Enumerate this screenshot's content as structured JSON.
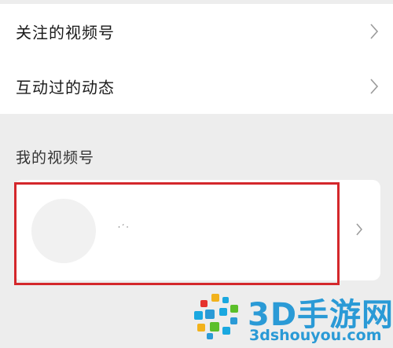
{
  "menu": {
    "items": [
      {
        "label": "关注的视频号"
      },
      {
        "label": "互动过的动态"
      }
    ]
  },
  "my_channels": {
    "section_title": "我的视频号",
    "card": {
      "name": "· ′ ·"
    }
  },
  "watermark": {
    "brand": "3D手游网",
    "url": "3dshouyou.com",
    "brand_color": "#2a9ad6"
  },
  "colors": {
    "highlight_border": "#d4272b",
    "page_background": "#ededed"
  },
  "icons": {
    "row_chevron": "chevron-right-icon",
    "watermark_logo": "3d-logo-icon"
  }
}
